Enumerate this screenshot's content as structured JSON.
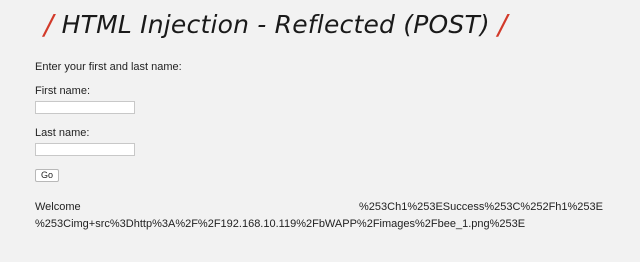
{
  "header": {
    "title": "HTML Injection - Reflected (POST)",
    "slash": "/",
    "accent_color": "#d23a2a"
  },
  "form": {
    "prompt": "Enter your first and last name:",
    "first_name_label": "First name:",
    "first_name_value": "",
    "last_name_label": "Last name:",
    "last_name_value": "",
    "go_label": "Go"
  },
  "output": {
    "welcome": "Welcome",
    "payload_line1": "%253Ch1%253ESuccess%253C%252Fh1%253E",
    "payload_line2": "%253Cimg+src%3Dhttp%3A%2F%2F192.168.10.119%2FbWAPP%2Fimages%2Fbee_1.png%253E"
  }
}
